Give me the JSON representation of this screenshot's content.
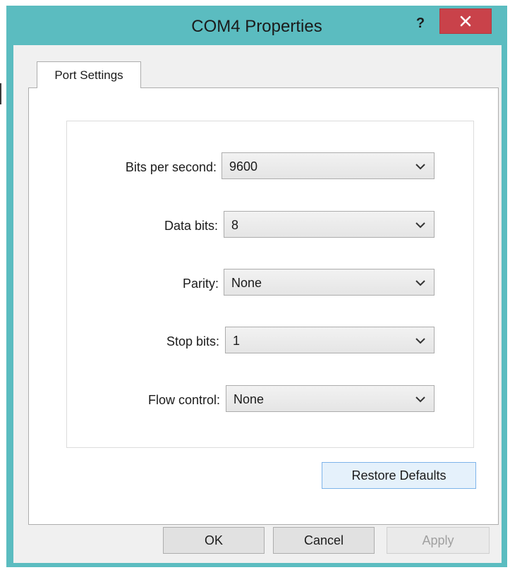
{
  "window": {
    "title": "COM4 Properties",
    "help_label": "?"
  },
  "tabs": [
    {
      "label": "Port Settings"
    }
  ],
  "fields": [
    {
      "label": "Bits per second:",
      "value": "9600"
    },
    {
      "label": "Data bits:",
      "value": "8"
    },
    {
      "label": "Parity:",
      "value": "None"
    },
    {
      "label": "Stop bits:",
      "value": "1"
    },
    {
      "label": "Flow control:",
      "value": "None"
    }
  ],
  "buttons": {
    "restore": "Restore Defaults",
    "ok": "OK",
    "cancel": "Cancel",
    "apply": "Apply"
  },
  "colors": {
    "frame": "#5bbcc0",
    "close_button": "#c9424a",
    "dialog_bg": "#f0f0f0",
    "restore_highlight": "#e5f1fb"
  }
}
